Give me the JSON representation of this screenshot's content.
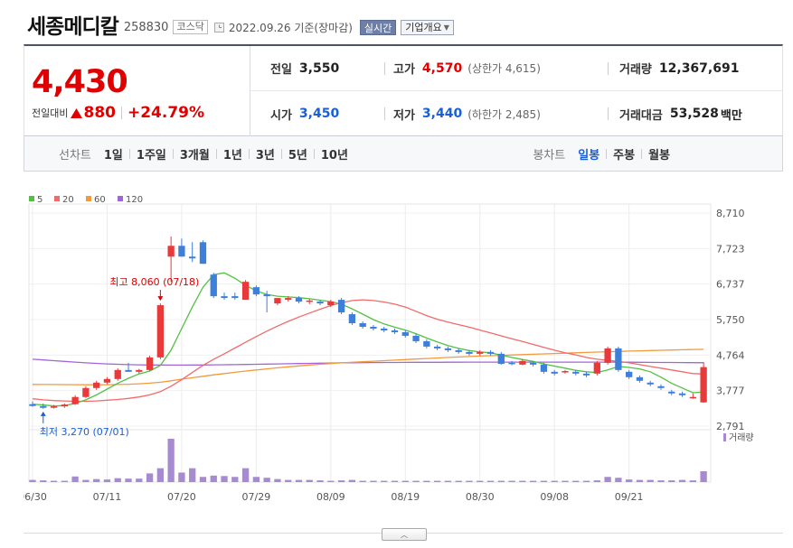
{
  "header": {
    "name": "세종메디칼",
    "code": "258830",
    "market": "코스닥",
    "date": "2022.09.26 기준(장마감)",
    "live_btn": "실시간",
    "info_btn": "기업개요"
  },
  "quote": {
    "price": "4,430",
    "change_label": "전일대비",
    "change": "880",
    "change_pct": "+24.79%",
    "prev_label": "전일",
    "prev": "3,550",
    "high_label": "고가",
    "high": "4,570",
    "upper_limit": "(상한가 4,615)",
    "volume_label": "거래량",
    "volume": "12,367,691",
    "open_label": "시가",
    "open": "3,450",
    "low_label": "저가",
    "low": "3,440",
    "lower_limit": "(하한가 2,485)",
    "amount_label": "거래대금",
    "amount": "53,528",
    "amount_unit": "백만"
  },
  "toolbar": {
    "line_label": "선차트",
    "line_items": [
      "1일",
      "1주일",
      "3개월",
      "1년",
      "3년",
      "5년",
      "10년"
    ],
    "candle_label": "봉차트",
    "candle_items": [
      "일봉",
      "주봉",
      "월봉"
    ],
    "active_candle": 0
  },
  "colors": {
    "up": "#e83a3a",
    "down": "#3d7fd9",
    "ma5": "#52c141",
    "ma20": "#f36a6a",
    "ma60": "#f29a3c",
    "ma120": "#a466d6",
    "volume": "#a78bd0"
  },
  "chart_data": {
    "type": "candlestick",
    "legend": [
      {
        "name": "5",
        "color": "#52c141"
      },
      {
        "name": "20",
        "color": "#f36a6a"
      },
      {
        "name": "60",
        "color": "#f29a3c"
      },
      {
        "name": "120",
        "color": "#a466d6"
      }
    ],
    "y_ticks": [
      "8,710",
      "7,723",
      "6,737",
      "5,750",
      "4,764",
      "3,777",
      "2,791"
    ],
    "ylim": [
      2791,
      8710
    ],
    "x_ticks": [
      {
        "label": "06/30",
        "index": 0
      },
      {
        "label": "07/11",
        "index": 7
      },
      {
        "label": "07/20",
        "index": 14
      },
      {
        "label": "07/29",
        "index": 21
      },
      {
        "label": "08/09",
        "index": 28
      },
      {
        "label": "08/19",
        "index": 35
      },
      {
        "label": "08/30",
        "index": 42
      },
      {
        "label": "09/08",
        "index": 49
      },
      {
        "label": "09/21",
        "index": 56
      }
    ],
    "max_annotation": "최고 8,060 (07/18)",
    "min_annotation": "최저 3,270 (07/01)",
    "max_index": 12,
    "min_index": 1,
    "volume_label": "거래량",
    "ohlc": [
      [
        3400,
        3480,
        3330,
        3350
      ],
      [
        3350,
        3420,
        3270,
        3300
      ],
      [
        3300,
        3380,
        3280,
        3340
      ],
      [
        3340,
        3420,
        3300,
        3390
      ],
      [
        3400,
        3650,
        3380,
        3600
      ],
      [
        3600,
        3900,
        3570,
        3850
      ],
      [
        3850,
        4050,
        3800,
        4000
      ],
      [
        4000,
        4150,
        3960,
        4100
      ],
      [
        4100,
        4400,
        4050,
        4350
      ],
      [
        4350,
        4550,
        4300,
        4300
      ],
      [
        4300,
        4380,
        4250,
        4350
      ],
      [
        4350,
        4750,
        4320,
        4700
      ],
      [
        4700,
        6200,
        4650,
        6150
      ],
      [
        7500,
        8060,
        6800,
        7800
      ],
      [
        7800,
        8000,
        7500,
        7500
      ],
      [
        7500,
        7900,
        7350,
        7450
      ],
      [
        7900,
        7950,
        7300,
        7300
      ],
      [
        7000,
        7050,
        6350,
        6400
      ],
      [
        6400,
        6500,
        6300,
        6350
      ],
      [
        6400,
        6500,
        6300,
        6350
      ],
      [
        6300,
        6850,
        6300,
        6800
      ],
      [
        6650,
        6700,
        6400,
        6450
      ],
      [
        6450,
        6550,
        5950,
        6400
      ],
      [
        6200,
        6350,
        6150,
        6350
      ],
      [
        6300,
        6400,
        6250,
        6350
      ],
      [
        6350,
        6400,
        6200,
        6250
      ],
      [
        6250,
        6320,
        6180,
        6280
      ],
      [
        6250,
        6300,
        6150,
        6200
      ],
      [
        6150,
        6300,
        6100,
        6250
      ],
      [
        6300,
        6350,
        5900,
        5950
      ],
      [
        5900,
        5950,
        5600,
        5650
      ],
      [
        5650,
        5700,
        5500,
        5550
      ],
      [
        5550,
        5600,
        5450,
        5500
      ],
      [
        5500,
        5550,
        5400,
        5450
      ],
      [
        5450,
        5500,
        5350,
        5400
      ],
      [
        5400,
        5450,
        5250,
        5300
      ],
      [
        5300,
        5350,
        5100,
        5150
      ],
      [
        5150,
        5200,
        4950,
        5000
      ],
      [
        5000,
        5050,
        4900,
        4950
      ],
      [
        4950,
        5000,
        4850,
        4900
      ],
      [
        4900,
        4950,
        4800,
        4850
      ],
      [
        4850,
        4900,
        4750,
        4800
      ],
      [
        4800,
        4900,
        4750,
        4850
      ],
      [
        4850,
        4900,
        4750,
        4800
      ],
      [
        4800,
        4850,
        4500,
        4520
      ],
      [
        4550,
        4600,
        4480,
        4520
      ],
      [
        4500,
        4650,
        4480,
        4600
      ],
      [
        4550,
        4600,
        4450,
        4500
      ],
      [
        4500,
        4550,
        4250,
        4300
      ],
      [
        4300,
        4350,
        4200,
        4250
      ],
      [
        4300,
        4350,
        4250,
        4320
      ],
      [
        4300,
        4350,
        4200,
        4250
      ],
      [
        4250,
        4300,
        4150,
        4200
      ],
      [
        4250,
        4600,
        4200,
        4550
      ],
      [
        4550,
        5000,
        4500,
        4950
      ],
      [
        4950,
        5000,
        4300,
        4350
      ],
      [
        4300,
        4350,
        4100,
        4150
      ],
      [
        4150,
        4200,
        4000,
        4050
      ],
      [
        4000,
        4050,
        3900,
        3950
      ],
      [
        3900,
        3950,
        3800,
        3850
      ],
      [
        3750,
        3800,
        3650,
        3700
      ],
      [
        3700,
        3750,
        3600,
        3650
      ],
      [
        3600,
        3700,
        3550,
        3600
      ],
      [
        3450,
        4570,
        3440,
        4430
      ]
    ],
    "volume": [
      0.05,
      0.04,
      0.03,
      0.03,
      0.13,
      0.05,
      0.07,
      0.06,
      0.09,
      0.08,
      0.08,
      0.2,
      0.32,
      1.0,
      0.22,
      0.32,
      0.12,
      0.15,
      0.14,
      0.12,
      0.32,
      0.12,
      0.1,
      0.07,
      0.05,
      0.05,
      0.05,
      0.04,
      0.03,
      0.04,
      0.05,
      0.03,
      0.03,
      0.03,
      0.03,
      0.03,
      0.03,
      0.03,
      0.03,
      0.03,
      0.03,
      0.03,
      0.03,
      0.03,
      0.03,
      0.03,
      0.03,
      0.03,
      0.03,
      0.03,
      0.03,
      0.03,
      0.03,
      0.04,
      0.12,
      0.1,
      0.06,
      0.05,
      0.05,
      0.04,
      0.04,
      0.05,
      0.04,
      0.25
    ],
    "ma5": [
      3400,
      3380,
      3350,
      3360,
      3420,
      3520,
      3660,
      3820,
      3980,
      4120,
      4240,
      4320,
      4480,
      4900,
      5500,
      6100,
      6650,
      7000,
      7050,
      6900,
      6700,
      6550,
      6450,
      6400,
      6380,
      6360,
      6330,
      6290,
      6250,
      6180,
      6050,
      5900,
      5750,
      5630,
      5540,
      5460,
      5360,
      5240,
      5130,
      5030,
      4950,
      4890,
      4850,
      4830,
      4760,
      4700,
      4640,
      4590,
      4520,
      4460,
      4400,
      4340,
      4300,
      4280,
      4350,
      4450,
      4420,
      4380,
      4300,
      4150,
      3980,
      3850,
      3720,
      3740
    ],
    "ma20": [
      3550,
      3520,
      3500,
      3490,
      3480,
      3480,
      3490,
      3510,
      3530,
      3560,
      3600,
      3660,
      3750,
      3900,
      4080,
      4280,
      4480,
      4650,
      4800,
      4960,
      5120,
      5280,
      5430,
      5570,
      5700,
      5820,
      5930,
      6040,
      6140,
      6220,
      6280,
      6300,
      6280,
      6240,
      6180,
      6100,
      5980,
      5860,
      5760,
      5680,
      5610,
      5540,
      5460,
      5380,
      5300,
      5220,
      5140,
      5060,
      4980,
      4900,
      4830,
      4770,
      4700,
      4650,
      4620,
      4590,
      4550,
      4500,
      4450,
      4400,
      4350,
      4300,
      4250,
      4240
    ],
    "ma60": [
      3950,
      3948,
      3946,
      3944,
      3942,
      3940,
      3940,
      3942,
      3946,
      3955,
      3968,
      3985,
      4010,
      4050,
      4095,
      4135,
      4175,
      4215,
      4250,
      4285,
      4320,
      4350,
      4380,
      4410,
      4440,
      4465,
      4490,
      4510,
      4530,
      4550,
      4565,
      4580,
      4595,
      4610,
      4625,
      4640,
      4655,
      4670,
      4685,
      4700,
      4712,
      4724,
      4736,
      4748,
      4758,
      4768,
      4778,
      4788,
      4798,
      4808,
      4818,
      4828,
      4838,
      4848,
      4858,
      4866,
      4874,
      4882,
      4890,
      4898,
      4906,
      4914,
      4920,
      4925
    ],
    "ma120": [
      4650,
      4630,
      4610,
      4590,
      4570,
      4550,
      4535,
      4520,
      4510,
      4500,
      4495,
      4490,
      4488,
      4487,
      4487,
      4488,
      4490,
      4493,
      4496,
      4500,
      4505,
      4510,
      4515,
      4520,
      4525,
      4530,
      4535,
      4540,
      4545,
      4550,
      4552,
      4554,
      4556,
      4558,
      4560,
      4562,
      4563,
      4564,
      4565,
      4566,
      4567,
      4568,
      4569,
      4570,
      4570,
      4570,
      4570,
      4570,
      4570,
      4570,
      4570,
      4570,
      4570,
      4570,
      4570,
      4568,
      4566,
      4564,
      4562,
      4560,
      4558,
      4556,
      4554,
      4552
    ]
  }
}
